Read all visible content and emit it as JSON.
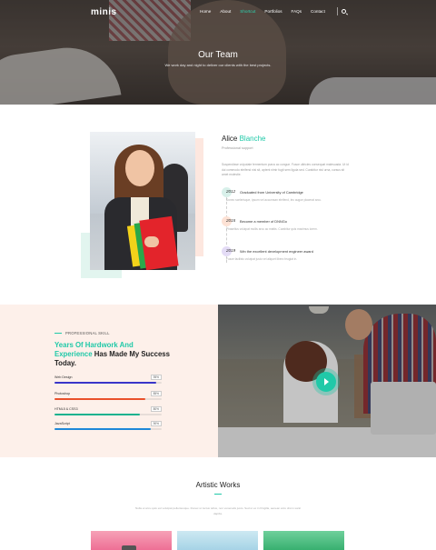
{
  "header": {
    "logo": "minis",
    "nav": [
      "Home",
      "About",
      "Shortcut",
      "Portfolios",
      "FAQs",
      "Contact"
    ],
    "active_index": 2,
    "search_icon": "search-icon",
    "title": "Our Team",
    "subtitle": "We work day and night to deliver our clients with the best projects."
  },
  "profile": {
    "first_name": "Alice",
    "last_name": "Blanche",
    "role": "Professional support",
    "bio": "Suspendisse vulputate fermentum purus ac congue. Fusce ultricies consequat malesuada. Ut id dui commodo eleifend nisi sit, aptent nimir fugit sem ligula sed. Curabitur nisl urna, cursus sit amet molestie.",
    "timeline": [
      {
        "year": "2012",
        "title": "Graduated from University of Cambridge",
        "desc": "Donec scelerisque, ipsum vel accumsan eleifend, leo augue placerat arcu.",
        "color": "#d8f0ea"
      },
      {
        "year": "2015",
        "title": "Become a member of DNNGo",
        "desc": "Phasellus volutpat mollis arcu ac mattis. Curabitur quis maximus lorem.",
        "color": "#fde2d5"
      },
      {
        "year": "2019",
        "title": "Win the  excellent development engineer award",
        "desc": "Fusce facilisis volutpat justo vel aliquet libero feugiat in.",
        "color": "#e4dcf6"
      }
    ]
  },
  "skills": {
    "eyebrow": "PROFESSIONAL SKILL",
    "heading_highlight": "Years Of Hardwork And Experience",
    "heading_rest": " Has Made My Success Today.",
    "items": [
      {
        "label": "Web Design",
        "percent": "95%",
        "value": 0.95,
        "color": "#3a35c9"
      },
      {
        "label": "Photoshop",
        "percent": "85%",
        "value": 0.85,
        "color": "#e9502b"
      },
      {
        "label": "HTML5 & CSS3",
        "percent": "80%",
        "value": 0.8,
        "color": "#17b28e"
      },
      {
        "label": "JavaScript",
        "percent": "90%",
        "value": 0.9,
        "color": "#1e88d8"
      }
    ]
  },
  "video": {
    "play_icon": "play-icon"
  },
  "works": {
    "title": "Artistic Works",
    "subtitle": "Nulla et arcu quis est volutpat pellentesque. Donec ut luctus tellus, non venenatis justo. Sed ut ex in fringilla, aenean arcu dnnm sanit dapibs."
  }
}
